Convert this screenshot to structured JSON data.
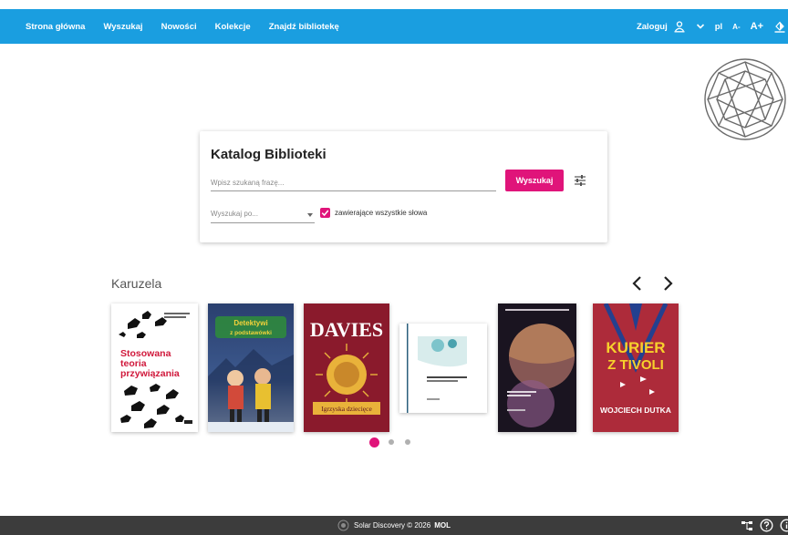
{
  "nav": {
    "items": [
      {
        "label": "Strona główna"
      },
      {
        "label": "Wyszukaj"
      },
      {
        "label": "Nowości"
      },
      {
        "label": "Kolekcje"
      },
      {
        "label": "Znajdź bibliotekę"
      }
    ],
    "login_label": "Zaloguj",
    "language": "pl",
    "font_smaller": "A-",
    "font_larger": "A+"
  },
  "search": {
    "title": "Katalog Biblioteki",
    "placeholder": "Wpisz szukaną frazę...",
    "button_label": "Wyszukaj",
    "search_by_placeholder": "Wyszukaj po...",
    "all_words_label": "zawierające wszystkie słowa",
    "all_words_checked": true
  },
  "carousel": {
    "title": "Karuzela",
    "books": [
      {
        "title_lines": [
          "Stosowana",
          "teoria",
          "przywiązania"
        ]
      },
      {
        "title_lines": [
          "Detektywi",
          "z podstawówki"
        ]
      },
      {
        "author": "DAVIES",
        "subtitle": "Igrzyska dziecięce"
      },
      {
        "title_lines": []
      },
      {
        "title_lines": []
      },
      {
        "title_lines": [
          "KURIER",
          "Z TIVOLI"
        ],
        "author": "WOJCIECH DUTKA"
      }
    ],
    "dots": 3,
    "active_dot": 0
  },
  "footer": {
    "text": "Solar Discovery © 2026",
    "brand": "MOL"
  },
  "colors": {
    "primary": "#1a9ee0",
    "accent": "#e0147a",
    "footer_bg": "#3c3c3c"
  }
}
